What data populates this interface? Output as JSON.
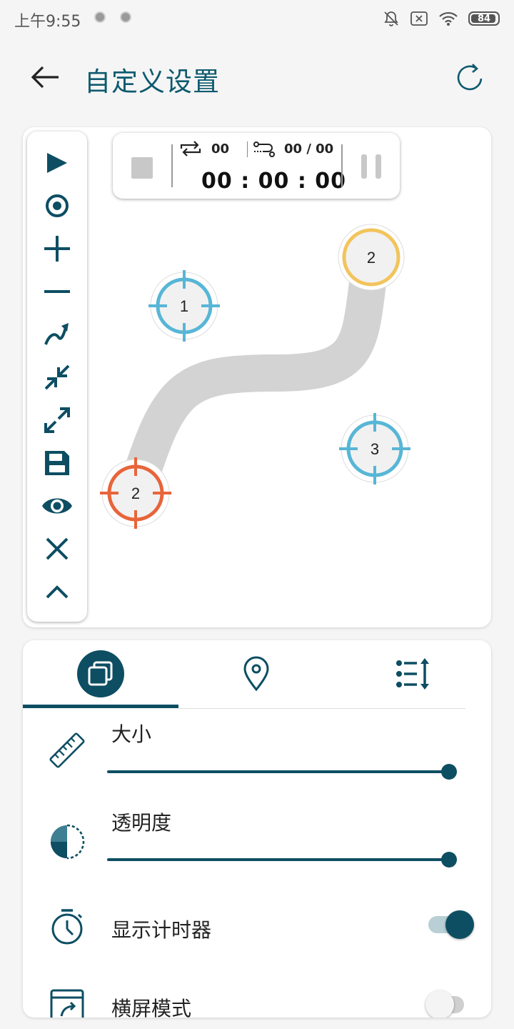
{
  "status_bar": {
    "time": "上午9:55",
    "battery": "84"
  },
  "header": {
    "title": "自定义设置"
  },
  "toolbar": {
    "items": [
      "play-icon",
      "target-icon",
      "plus-icon",
      "minus-icon",
      "swipe-icon",
      "collapse-icon",
      "expand-icon",
      "save-icon",
      "eye-icon",
      "close-icon",
      "chevron-up-icon"
    ]
  },
  "timer": {
    "loop_count": "00",
    "sequence": "00 / 00",
    "clock": "00 : 00 : 00"
  },
  "markers": [
    {
      "label": "1",
      "kind": "tap",
      "color": "#57b6d6"
    },
    {
      "label": "2",
      "kind": "swipe-end",
      "color": "#f2c45c"
    },
    {
      "label": "2",
      "kind": "swipe-start",
      "color": "#e8643a"
    },
    {
      "label": "3",
      "kind": "tap",
      "color": "#57b6d6"
    }
  ],
  "tabs": [
    {
      "icon": "layers-icon",
      "active": true
    },
    {
      "icon": "location-pin-icon",
      "active": false
    },
    {
      "icon": "list-sort-icon",
      "active": false
    }
  ],
  "settings": {
    "size_label": "大小",
    "size_value": 1.0,
    "opacity_label": "透明度",
    "opacity_value": 1.0,
    "show_timer_label": "显示计时器",
    "show_timer_on": true,
    "landscape_label": "横屏模式",
    "landscape_on": false
  },
  "colors": {
    "accent": "#0d4e63",
    "title": "#0e5a6e",
    "tap_marker": "#57b6d6",
    "swipe_start": "#e8643a",
    "swipe_end": "#f2c45c",
    "swipe_path": "#d3d3d3"
  }
}
